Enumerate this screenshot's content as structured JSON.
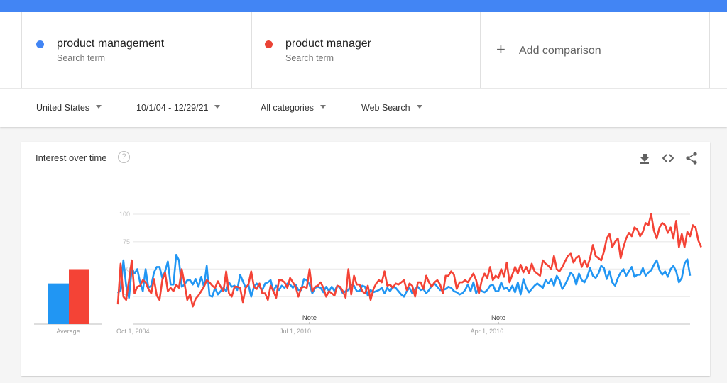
{
  "colors": {
    "brand_bar": "#4285f4",
    "series_blue": "#2196f3",
    "series_red": "#f44336",
    "term_dot_blue": "#4285f4",
    "term_dot_red": "#ea4335"
  },
  "terms": [
    {
      "name": "product management",
      "subtitle": "Search term",
      "color": "#4285f4"
    },
    {
      "name": "product manager",
      "subtitle": "Search term",
      "color": "#ea4335"
    }
  ],
  "add_comparison": {
    "icon": "plus-icon",
    "label": "Add comparison"
  },
  "filters": [
    {
      "label": "United States",
      "icon": "caret-down-icon"
    },
    {
      "label": "10/1/04 - 12/29/21",
      "icon": "caret-down-icon"
    },
    {
      "label": "All categories",
      "icon": "caret-down-icon"
    },
    {
      "label": "Web Search",
      "icon": "caret-down-icon"
    }
  ],
  "card": {
    "title": "Interest over time",
    "help_icon": "help-icon",
    "actions": [
      "download-icon",
      "embed-icon",
      "share-icon"
    ]
  },
  "chart_data": {
    "type": "line",
    "title": "Interest over time",
    "xlabel": "",
    "ylabel": "",
    "ylim": [
      0,
      100
    ],
    "yticks": [
      25,
      50,
      75,
      100
    ],
    "grid": true,
    "x_start": "2004-10",
    "x_end": "2021-12",
    "x_interval": "month",
    "xtick_labels": [
      "Oct 1, 2004",
      "Jul 1, 2010",
      "Apr 1, 2016"
    ],
    "xtick_months_from_start": [
      0,
      69,
      138
    ],
    "annotations": [
      {
        "label": "Note",
        "month_from_start": 69
      },
      {
        "label": "Note",
        "month_from_start": 137
      }
    ],
    "average": {
      "label": "Average",
      "values": [
        37,
        50
      ]
    },
    "series": [
      {
        "name": "product management",
        "color": "#2196f3",
        "values": [
          28,
          31,
          58,
          35,
          24,
          51,
          46,
          50,
          38,
          30,
          50,
          33,
          35,
          47,
          52,
          52,
          42,
          48,
          57,
          36,
          36,
          63,
          58,
          34,
          36,
          40,
          40,
          36,
          41,
          34,
          43,
          34,
          53,
          26,
          25,
          33,
          27,
          30,
          33,
          30,
          38,
          34,
          35,
          31,
          45,
          39,
          33,
          36,
          25,
          34,
          37,
          34,
          31,
          37,
          38,
          40,
          30,
          35,
          31,
          35,
          33,
          37,
          36,
          33,
          36,
          31,
          31,
          41,
          40,
          36,
          28,
          33,
          34,
          33,
          29,
          34,
          30,
          34,
          30,
          35,
          33,
          28,
          30,
          31,
          36,
          35,
          30,
          30,
          35,
          34,
          26,
          31,
          29,
          30,
          31,
          33,
          28,
          33,
          30,
          34,
          33,
          30,
          27,
          25,
          30,
          33,
          28,
          32,
          34,
          31,
          32,
          28,
          31,
          35,
          37,
          34,
          31,
          31,
          32,
          34,
          33,
          30,
          29,
          27,
          28,
          31,
          36,
          30,
          38,
          28,
          33,
          30,
          29,
          31,
          35,
          36,
          30,
          30,
          38,
          32,
          33,
          30,
          35,
          29,
          38,
          27,
          41,
          33,
          29,
          32,
          35,
          37,
          35,
          33,
          40,
          37,
          41,
          35,
          44,
          40,
          32,
          36,
          41,
          47,
          44,
          36,
          46,
          40,
          38,
          43,
          51,
          44,
          42,
          46,
          53,
          51,
          41,
          48,
          38,
          35,
          42,
          47,
          50,
          44,
          48,
          52,
          43,
          45,
          45,
          51,
          44,
          47,
          49,
          54,
          58,
          49,
          45,
          48,
          43,
          50,
          53,
          48,
          38,
          42,
          55,
          59,
          44
        ]
      },
      {
        "name": "product manager",
        "color": "#f44336",
        "values": [
          18,
          55,
          25,
          22,
          40,
          58,
          28,
          34,
          35,
          40,
          38,
          32,
          28,
          41,
          26,
          22,
          40,
          47,
          30,
          33,
          30,
          36,
          33,
          50,
          37,
          22,
          27,
          16,
          23,
          26,
          30,
          34,
          40,
          38,
          35,
          33,
          39,
          34,
          30,
          48,
          28,
          25,
          34,
          34,
          33,
          20,
          33,
          36,
          48,
          34,
          32,
          37,
          28,
          28,
          22,
          35,
          30,
          24,
          40,
          40,
          38,
          33,
          42,
          38,
          34,
          25,
          33,
          34,
          33,
          50,
          30,
          34,
          35,
          38,
          33,
          25,
          30,
          28,
          26,
          35,
          34,
          30,
          24,
          50,
          27,
          44,
          36,
          36,
          30,
          28,
          35,
          22,
          32,
          37,
          40,
          38,
          48,
          35,
          36,
          33,
          37,
          36,
          38,
          40,
          31,
          37,
          35,
          25,
          38,
          38,
          32,
          44,
          38,
          34,
          38,
          40,
          36,
          28,
          44,
          44,
          48,
          45,
          32,
          38,
          38,
          40,
          38,
          42,
          46,
          40,
          28,
          40,
          46,
          42,
          52,
          40,
          44,
          42,
          50,
          43,
          56,
          38,
          45,
          52,
          46,
          54,
          47,
          52,
          46,
          55,
          48,
          46,
          44,
          58,
          55,
          53,
          50,
          62,
          50,
          48,
          52,
          57,
          62,
          64,
          56,
          60,
          62,
          52,
          58,
          52,
          60,
          72,
          62,
          60,
          58,
          66,
          78,
          82,
          70,
          75,
          78,
          60,
          70,
          78,
          83,
          80,
          88,
          86,
          80,
          84,
          92,
          90,
          100,
          85,
          78,
          88,
          92,
          90,
          83,
          88,
          78,
          94,
          70,
          82,
          70,
          84,
          80,
          90,
          88,
          76,
          70
        ]
      }
    ]
  }
}
